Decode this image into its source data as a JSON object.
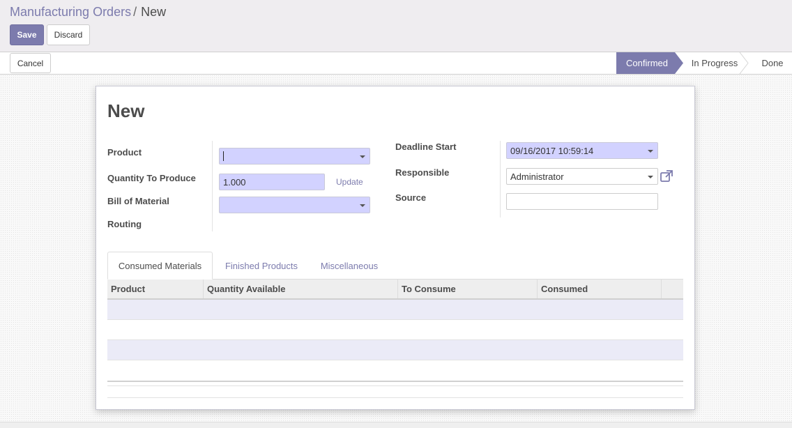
{
  "breadcrumb": {
    "parent": "Manufacturing Orders",
    "separator": "/",
    "current": "New"
  },
  "buttons": {
    "save": "Save",
    "discard": "Discard",
    "cancel": "Cancel"
  },
  "statusbar": {
    "stages": [
      "Confirmed",
      "In Progress",
      "Done"
    ],
    "active_stage": "Confirmed"
  },
  "form": {
    "title": "New",
    "labels": {
      "product": "Product",
      "quantity": "Quantity To Produce",
      "bom": "Bill of Material",
      "routing": "Routing",
      "deadline": "Deadline Start",
      "responsible": "Responsible",
      "source": "Source"
    },
    "values": {
      "product": "",
      "quantity": "1.000",
      "bom": "",
      "deadline": "09/16/2017 10:59:14",
      "responsible": "Administrator",
      "source": ""
    },
    "update_link": "Update"
  },
  "tabs": [
    "Consumed Materials",
    "Finished Products",
    "Miscellaneous"
  ],
  "table": {
    "columns": [
      "Product",
      "Quantity Available",
      "To Consume",
      "Consumed"
    ]
  },
  "colors": {
    "accent": "#7c7bad",
    "required_field": "#d2d2ff"
  },
  "icons": {
    "external_link": "external-link-icon",
    "dropdown": "caret-down-icon"
  }
}
